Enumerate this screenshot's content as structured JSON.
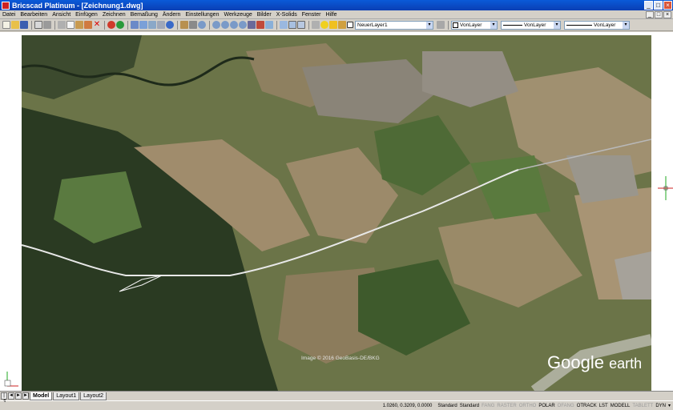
{
  "window": {
    "title": "Bricscad Platinum - [Zeichnung1.dwg]",
    "minimize": "_",
    "maximize": "□",
    "close": "×"
  },
  "menu": {
    "items": [
      "Datei",
      "Bearbeiten",
      "Ansicht",
      "Einfügen",
      "Zeichnen",
      "Bemaßung",
      "Ändern",
      "Einstellungen",
      "Werkzeuge",
      "Bilder",
      "X-Solids",
      "Fenster",
      "Hilfe"
    ]
  },
  "toolbar": {
    "layer": "NeuerLayer1",
    "color": "VonLayer",
    "linetype": "VonLayer",
    "lineweight": "VonLayer"
  },
  "map": {
    "attribution": "Image © 2016 GeoBasis-DE/BKG",
    "logo_google": "Google",
    "logo_earth": "earth"
  },
  "axis": {
    "y": "Y",
    "x": "X",
    "w": "W"
  },
  "tabs": {
    "nav": [
      "|◄",
      "◄",
      "►",
      "►|"
    ],
    "model": "Model",
    "layout1": "Layout1",
    "layout2": "Layout2"
  },
  "status": {
    "coords": "1.0260, 0.3209, 0.0000",
    "style1": "Standard",
    "style2": "Standard",
    "toggles": [
      {
        "label": "FANG",
        "on": false
      },
      {
        "label": "RASTER",
        "on": false
      },
      {
        "label": "ORTHO",
        "on": false
      },
      {
        "label": "POLAR",
        "on": true
      },
      {
        "label": "OFANG",
        "on": false
      },
      {
        "label": "OTRACK",
        "on": true
      },
      {
        "label": "LST",
        "on": true
      },
      {
        "label": "MODELL",
        "on": true
      },
      {
        "label": "TABLETT",
        "on": false
      },
      {
        "label": "DYN",
        "on": true
      }
    ],
    "menu_arrow": "▾"
  }
}
